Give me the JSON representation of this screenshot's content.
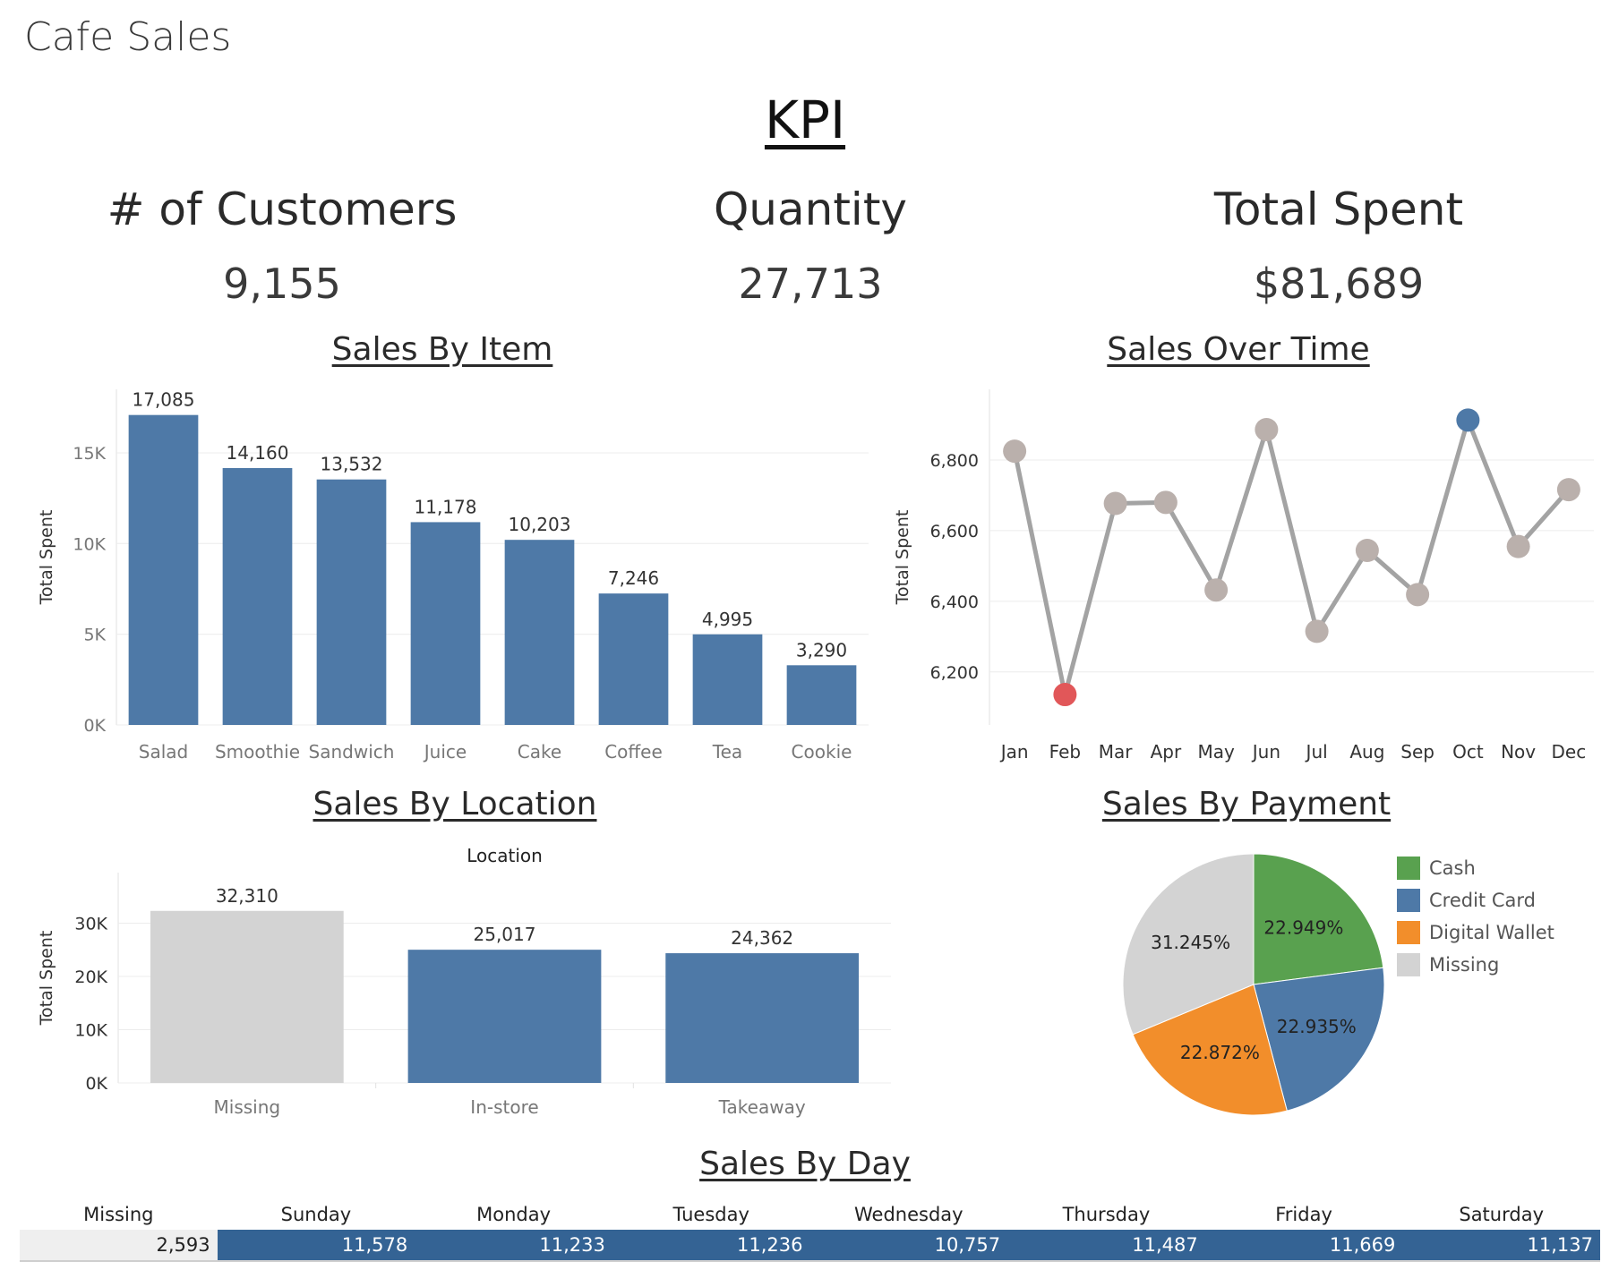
{
  "dashboard": {
    "title": "Cafe Sales"
  },
  "kpi": {
    "heading": "KPI",
    "items": [
      {
        "label": "# of Customers",
        "value": "9,155"
      },
      {
        "label": "Quantity",
        "value": "27,713"
      },
      {
        "label": "Total Spent",
        "value": "$81,689"
      }
    ]
  },
  "colors": {
    "bar": "#4e79a7",
    "missing": "#d3d3d3",
    "line": "#a3a3a3",
    "point": "#bab0ac",
    "high": "#4e79a7",
    "low": "#e15759",
    "cash": "#59a14f",
    "credit": "#4e79a7",
    "wallet": "#f28e2b",
    "header_row": "#346394"
  },
  "chart_data": [
    {
      "id": "sales_by_item",
      "type": "bar",
      "title": "Sales By Item",
      "ylabel": "Total Spent",
      "categories": [
        "Salad",
        "Smoothie",
        "Sandwich",
        "Juice",
        "Cake",
        "Coffee",
        "Tea",
        "Cookie"
      ],
      "values": [
        17085,
        14160,
        13532,
        11178,
        10203,
        7246,
        4995,
        3290
      ],
      "value_labels": [
        "17,085",
        "14,160",
        "13,532",
        "11,178",
        "10,203",
        "7,246",
        "4,995",
        "3,290"
      ],
      "yticks": [
        0,
        5000,
        10000,
        15000
      ],
      "ytick_labels": [
        "0K",
        "5K",
        "10K",
        "15K"
      ],
      "ylim": [
        0,
        18500
      ],
      "grid": true
    },
    {
      "id": "sales_over_time",
      "type": "line",
      "title": "Sales Over Time",
      "ylabel": "Total Spent",
      "x": [
        "Jan",
        "Feb",
        "Mar",
        "Apr",
        "May",
        "Jun",
        "Jul",
        "Aug",
        "Sep",
        "Oct",
        "Nov",
        "Dec"
      ],
      "values": [
        6825,
        6136,
        6677,
        6680,
        6432,
        6886,
        6315,
        6544,
        6419,
        6913,
        6555,
        6716
      ],
      "highlight": {
        "max_index": 9,
        "min_index": 1
      },
      "yticks": [
        6200,
        6400,
        6600,
        6800
      ],
      "ytick_labels": [
        "6,200",
        "6,400",
        "6,600",
        "6,800"
      ],
      "ylim": [
        6050,
        7000
      ],
      "grid": true
    },
    {
      "id": "sales_by_location",
      "type": "bar",
      "title": "Sales By Location",
      "header": "Location",
      "ylabel": "Total Spent",
      "categories": [
        "Missing",
        "In-store",
        "Takeaway"
      ],
      "values": [
        32310,
        25017,
        24362
      ],
      "value_labels": [
        "32,310",
        "25,017",
        "24,362"
      ],
      "yticks": [
        0,
        10000,
        20000,
        30000
      ],
      "ytick_labels": [
        "0K",
        "10K",
        "20K",
        "30K"
      ],
      "ylim": [
        0,
        39500
      ],
      "grid": true
    },
    {
      "id": "sales_by_payment",
      "type": "pie",
      "title": "Sales By Payment",
      "slices": [
        {
          "label": "Cash",
          "value": 22.949,
          "text": "22.949%",
          "color": "#59a14f"
        },
        {
          "label": "Credit Card",
          "value": 22.935,
          "text": "22.935%",
          "color": "#4e79a7"
        },
        {
          "label": "Digital Wallet",
          "value": 22.872,
          "text": "22.872%",
          "color": "#f28e2b"
        },
        {
          "label": "Missing",
          "value": 31.245,
          "text": "31.245%",
          "color": "#d3d3d3"
        }
      ],
      "legend_position": "right"
    },
    {
      "id": "sales_by_day",
      "type": "table",
      "title": "Sales By Day",
      "columns": [
        "Missing",
        "Sunday",
        "Monday",
        "Tuesday",
        "Wednesday",
        "Thursday",
        "Friday",
        "Saturday"
      ],
      "values": [
        "2,593",
        "11,578",
        "11,233",
        "11,236",
        "10,757",
        "11,487",
        "11,669",
        "11,137"
      ]
    }
  ]
}
